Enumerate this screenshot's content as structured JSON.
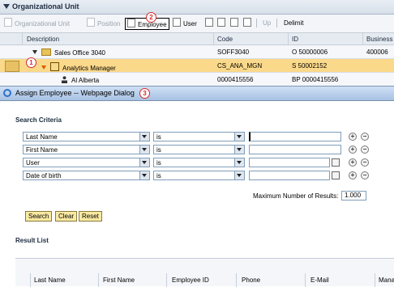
{
  "org_panel": {
    "title": "Organizational Unit",
    "toolbar": {
      "org_unit": "Organizational Unit",
      "position": "Position",
      "employee": "Employee",
      "user": "User",
      "up": "Up",
      "delimit": "Delimit"
    },
    "columns": [
      "Description",
      "Code",
      "ID",
      "Business"
    ],
    "rows": [
      {
        "description": "Sales Office 3040",
        "code": "SOFF3040",
        "id": "O 50000006",
        "business": "400006"
      },
      {
        "description": "Analytics Manager",
        "code": "CS_ANA_MGN",
        "id": "S 50002152",
        "business": ""
      },
      {
        "description": "Al Alberta",
        "code": "0000415556",
        "id": "BP 0000415556",
        "business": ""
      }
    ]
  },
  "callouts": {
    "one": "1",
    "two": "2",
    "three": "3"
  },
  "dialog": {
    "title": "Assign Employee -- Webpage Dialog",
    "search_criteria_label": "Search Criteria",
    "criteria": [
      {
        "field": "Last Name",
        "operator": "is",
        "value": ""
      },
      {
        "field": "First Name",
        "operator": "is",
        "value": ""
      },
      {
        "field": "User",
        "operator": "is",
        "value": ""
      },
      {
        "field": "Date of birth",
        "operator": "is",
        "value": ""
      }
    ],
    "max_results_label": "Maximum Number of Results:",
    "max_results_value": "1.000",
    "buttons": {
      "search": "Search",
      "clear": "Clear",
      "reset": "Reset"
    },
    "result_list_label": "Result List",
    "result_columns": [
      "Last Name",
      "First Name",
      "Employee ID",
      "Phone",
      "E-Mail",
      "Mana"
    ]
  },
  "colors": {
    "selected_row": "#fbd98a",
    "header_bg": "#d6dfe9",
    "button_bg": "#f9e9a2",
    "callout": "#d42a2a"
  }
}
